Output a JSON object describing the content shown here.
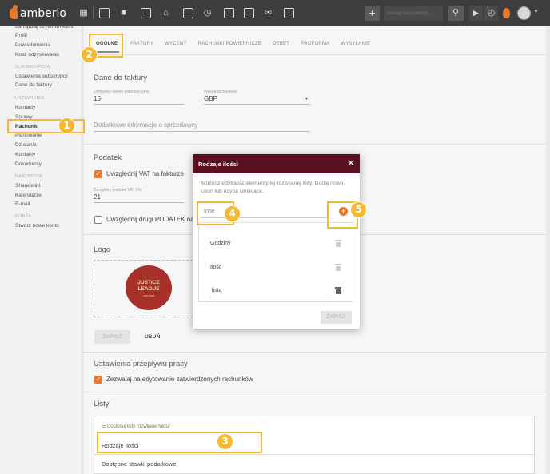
{
  "app": {
    "name": "amberlo"
  },
  "topbar": {
    "search_placeholder": "Szukaj wszystkiego...",
    "add_label": "+"
  },
  "sidebar": {
    "items_top": [
      "Zarządzaj użytkownikami",
      "Profil",
      "Powiadomienia",
      "Kosz odzyskiwania"
    ],
    "head_subscription": "SUBSKRYPCJA",
    "items_sub": [
      "Ustawienia subskrypcji",
      "Dane do faktury"
    ],
    "head_settings": "USTAWIENIA",
    "items_settings": [
      "Kontakty",
      "Sprawy",
      "Rachunki",
      "Planowanie",
      "Działania",
      "Kontakty",
      "Dokumenty"
    ],
    "head_tools": "NARZĘDZIA",
    "items_tools": [
      "Sharepoint",
      "Kalendarze",
      "E-mail"
    ],
    "head_account": "KONTA",
    "items_account": [
      "Stwórz nowe konto"
    ]
  },
  "tabs": [
    "OGÓLNE",
    "FAKTURY",
    "WYCENY",
    "RACHUNKI POWIERNICZE",
    "DEBET",
    "PROFORMA",
    "WYSYŁANIE"
  ],
  "invoice_data": {
    "title": "Dane do faktury",
    "payment_label": "Domyślny termin płatności (dni)",
    "payment_value": "15",
    "currency_label": "Waluta rachunków",
    "currency_value": "GBP",
    "extra_info": "Dodatkowe informacje o sprzedawcy"
  },
  "tax": {
    "title": "Podatek",
    "vat_check": "Uwzględnij VAT na fakturze",
    "vat_label": "Domyślny podatek VAT (%)",
    "vat_value": "21",
    "second_tax": "Uwzględnij drugi PODATEK na fakturze"
  },
  "logo": {
    "title": "Logo",
    "brand_line1": "JUSTICE",
    "brand_line2": "LEAGUE",
    "brand_sub": "LAW FIRM",
    "save": "ZAPISZ",
    "remove": "USUŃ"
  },
  "workflow": {
    "title": "Ustawienia przepływu pracy",
    "approve_check": "Zezwalaj na edytowanie zatwierdzonych rachunków"
  },
  "lists": {
    "title": "Listy",
    "caption": "☰ Dostosuj listy rozwijane faktur",
    "row1": "Rodzaje ilości",
    "row2": "Dostępne stawki podatkowe"
  },
  "dialog": {
    "title": "Rodzaje ilości",
    "close": "✕",
    "description": "Możesz edytować elementy tej rozwijanej listy. Dodaj nowe, usuń lub edytuj istniejące.",
    "input_placeholder": "Inne",
    "items": [
      "Godziny",
      "Ilość",
      "lista"
    ],
    "save": "ZAPISZ"
  },
  "callouts": [
    "1",
    "2",
    "3",
    "4",
    "5"
  ],
  "colors": {
    "accent": "#e8782a",
    "dialog_header": "#5a1020",
    "callout": "#f5b82e",
    "topbar": "#3d3d3d"
  }
}
